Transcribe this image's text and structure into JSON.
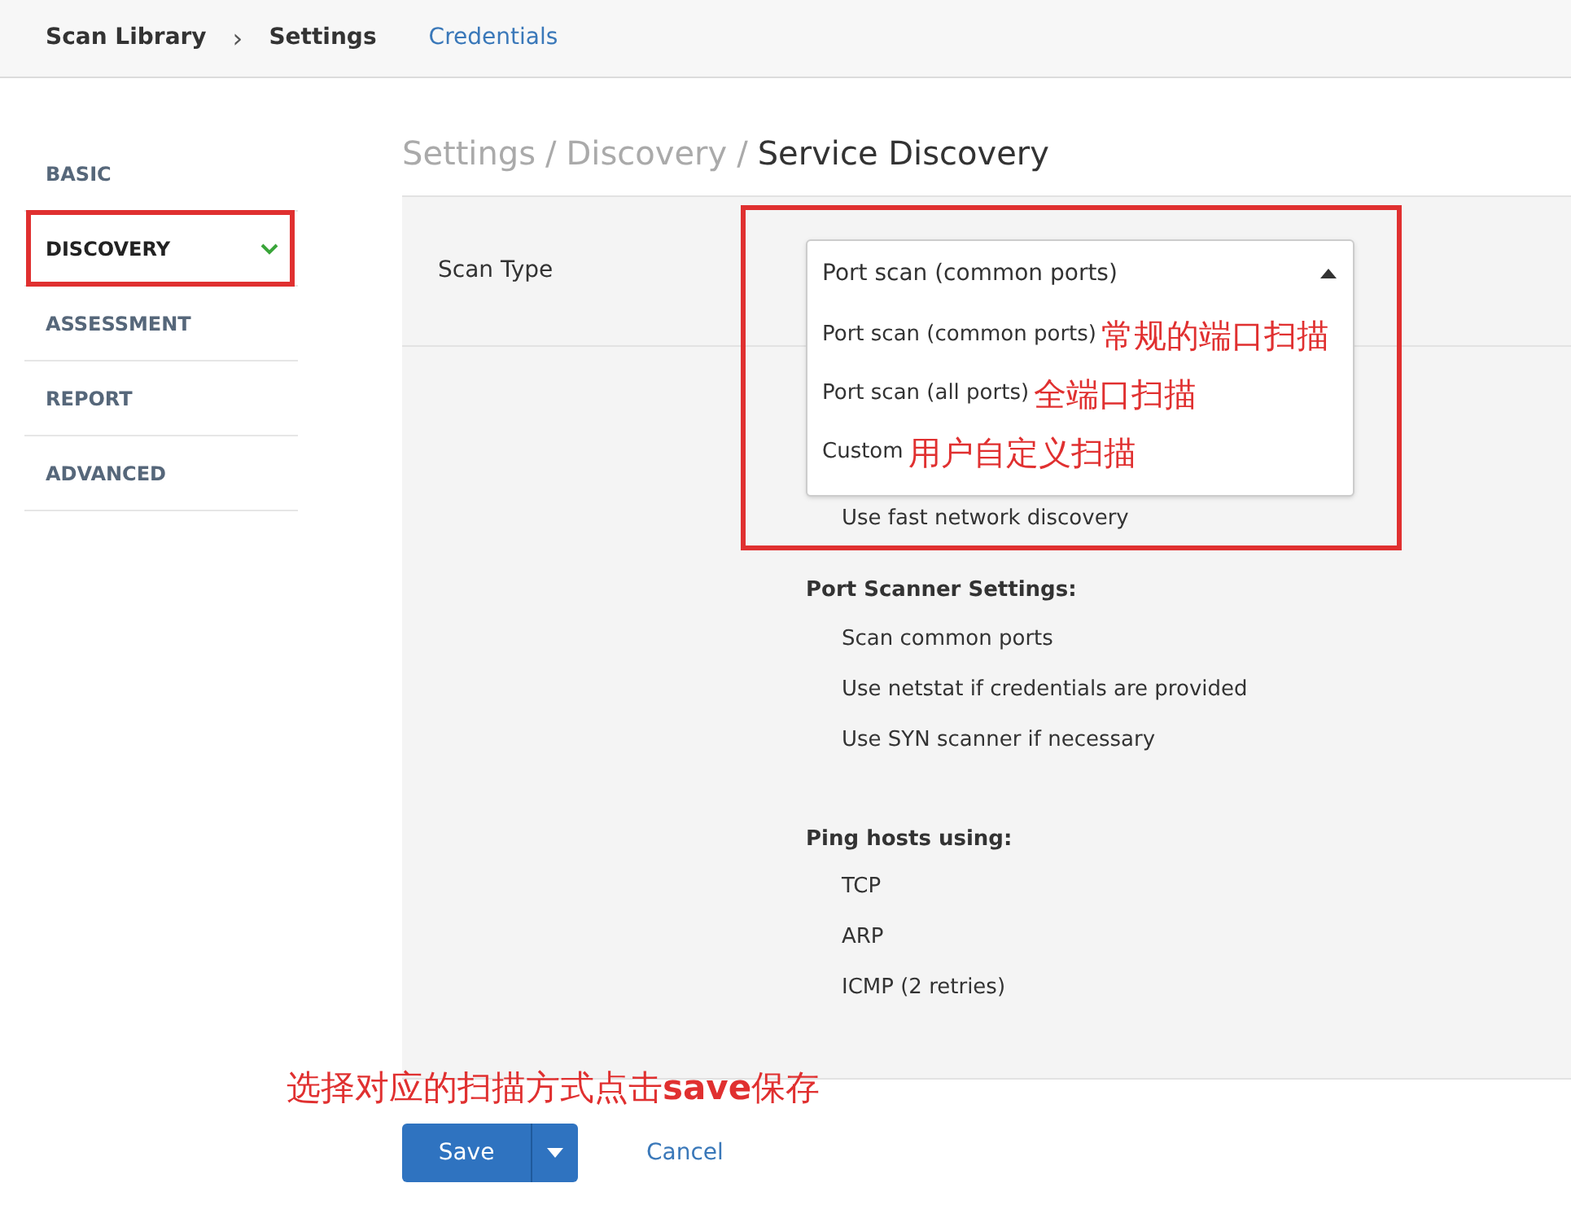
{
  "top_nav": {
    "breadcrumb": [
      {
        "label": "Scan Library"
      },
      {
        "label": "Settings"
      }
    ],
    "breadcrumb_separator": "›",
    "tabs": [
      {
        "label": "Credentials",
        "selected": false
      }
    ]
  },
  "sidebar": {
    "items": [
      {
        "label": "BASIC",
        "selected": false,
        "highlighted": false
      },
      {
        "label": "DISCOVERY",
        "selected": true,
        "highlighted": true
      },
      {
        "label": "ASSESSMENT",
        "selected": false,
        "highlighted": false
      },
      {
        "label": "REPORT",
        "selected": false,
        "highlighted": false
      },
      {
        "label": "ADVANCED",
        "selected": false,
        "highlighted": false
      }
    ]
  },
  "page_title": {
    "path": [
      "Settings",
      "Discovery"
    ],
    "separator": "/",
    "current": "Service Discovery"
  },
  "scan_type": {
    "label": "Scan Type",
    "value": "Port scan (common ports)",
    "expanded": true,
    "options": [
      {
        "label": "Port scan (common ports)",
        "note": "常规的端口扫描"
      },
      {
        "label": "Port scan (all ports)",
        "note": "全端口扫描"
      },
      {
        "label": "Custom",
        "note": "用户自定义扫描"
      }
    ]
  },
  "discovery_option": "Use fast network discovery",
  "sections": [
    {
      "heading": "Port Scanner Settings:",
      "items": [
        "Scan common ports",
        "Use netstat if credentials are provided",
        "Use SYN scanner if necessary"
      ]
    },
    {
      "heading": "Ping hosts using:",
      "items": [
        "TCP",
        "ARP",
        "ICMP (2 retries)"
      ]
    }
  ],
  "annotation": "选择对应的扫描方式点击**save**保存",
  "buttons": {
    "save": "Save",
    "cancel": "Cancel"
  }
}
